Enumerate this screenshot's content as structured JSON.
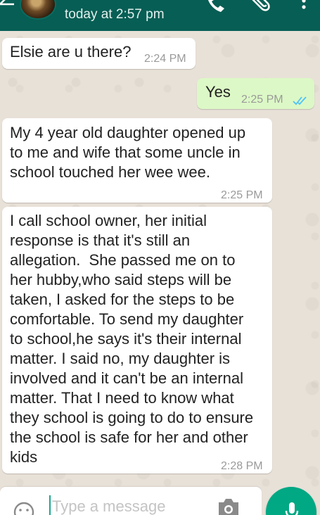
{
  "header": {
    "last_seen": "today at 2:57 pm",
    "icons": [
      "back-arrow-icon",
      "phone-icon",
      "paperclip-icon",
      "more-vert-icon"
    ],
    "background_color": "#075e54"
  },
  "messages": [
    {
      "direction": "incoming",
      "text": "Elsie are u there?",
      "time": "2:24 PM"
    },
    {
      "direction": "outgoing",
      "text": "Yes",
      "time": "2:25 PM",
      "status": "read"
    },
    {
      "direction": "incoming",
      "text": "My 4 year old daughter opened up\nto me and wife that some uncle in\nschool touched her wee wee.",
      "time": "2:25 PM"
    },
    {
      "direction": "incoming",
      "text": "I call school owner, her initial\nresponse is that it's still an\nallegation.  She passed me on to\nher hubby,who said steps will be\ntaken, I asked for the steps to be\ncomfortable. To send my daughter\nto school,he says it's their internal\nmatter. I said no, my daughter is\ninvolved and it can't be an internal\nmatter. That I need to know what\nthey school is going to do to ensure\nthe school is safe for her and other\nkids",
      "time": "2:28 PM"
    }
  ],
  "composer": {
    "placeholder": "Type a message",
    "value": "",
    "icons": [
      "emoji-icon",
      "camera-icon",
      "mic-icon"
    ]
  },
  "colors": {
    "incoming_bubble": "#ffffff",
    "outgoing_bubble": "#dcf8c6",
    "read_ticks": "#4fc3f7",
    "accent": "#00a884"
  }
}
